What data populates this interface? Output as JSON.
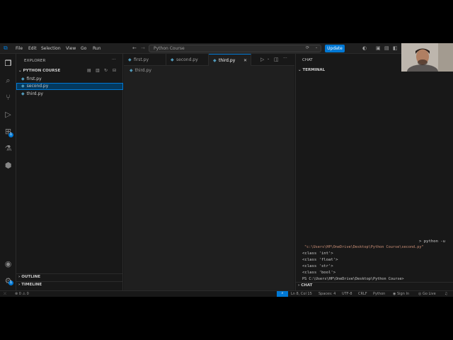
{
  "menu": [
    "File",
    "Edit",
    "Selection",
    "View",
    "Go",
    "Run"
  ],
  "search": {
    "text": "Python Course"
  },
  "update_label": "Update",
  "explorer": {
    "header": "EXPLORER",
    "folder": "PYTHON COURSE",
    "files": [
      "first.py",
      "second.py",
      "third.py"
    ],
    "outline": "OUTLINE",
    "timeline": "TIMELINE"
  },
  "tabs": [
    "first.py",
    "second.py",
    "third.py"
  ],
  "breadcrumb": "third.py",
  "panel": {
    "chat_tab": "CHAT",
    "terminal_title": "TERMINAL",
    "lines": [
      "> python -u",
      "\"c:\\Users\\HP\\OneDrive\\Desktop\\Python Course\\second.py\"",
      "<class 'int'>",
      "<class 'float'>",
      "<class 'str'>",
      "<class 'bool'>",
      "PS C:\\Users\\HP\\OneDrive\\Desktop\\Python Course>"
    ],
    "chat_footer": "CHAT"
  },
  "status": {
    "errors": "0",
    "warnings": "0",
    "position": "Ln 8, Col 15",
    "spaces": "Spaces: 4",
    "encoding": "UTF-8",
    "eol": "CRLF",
    "language": "Python",
    "signin": "Sign In",
    "golive": "Go Live"
  },
  "badges": {
    "extensions": "1",
    "accounts": "1"
  },
  "colors": {
    "accent": "#0078d4",
    "python": "#519aba"
  }
}
